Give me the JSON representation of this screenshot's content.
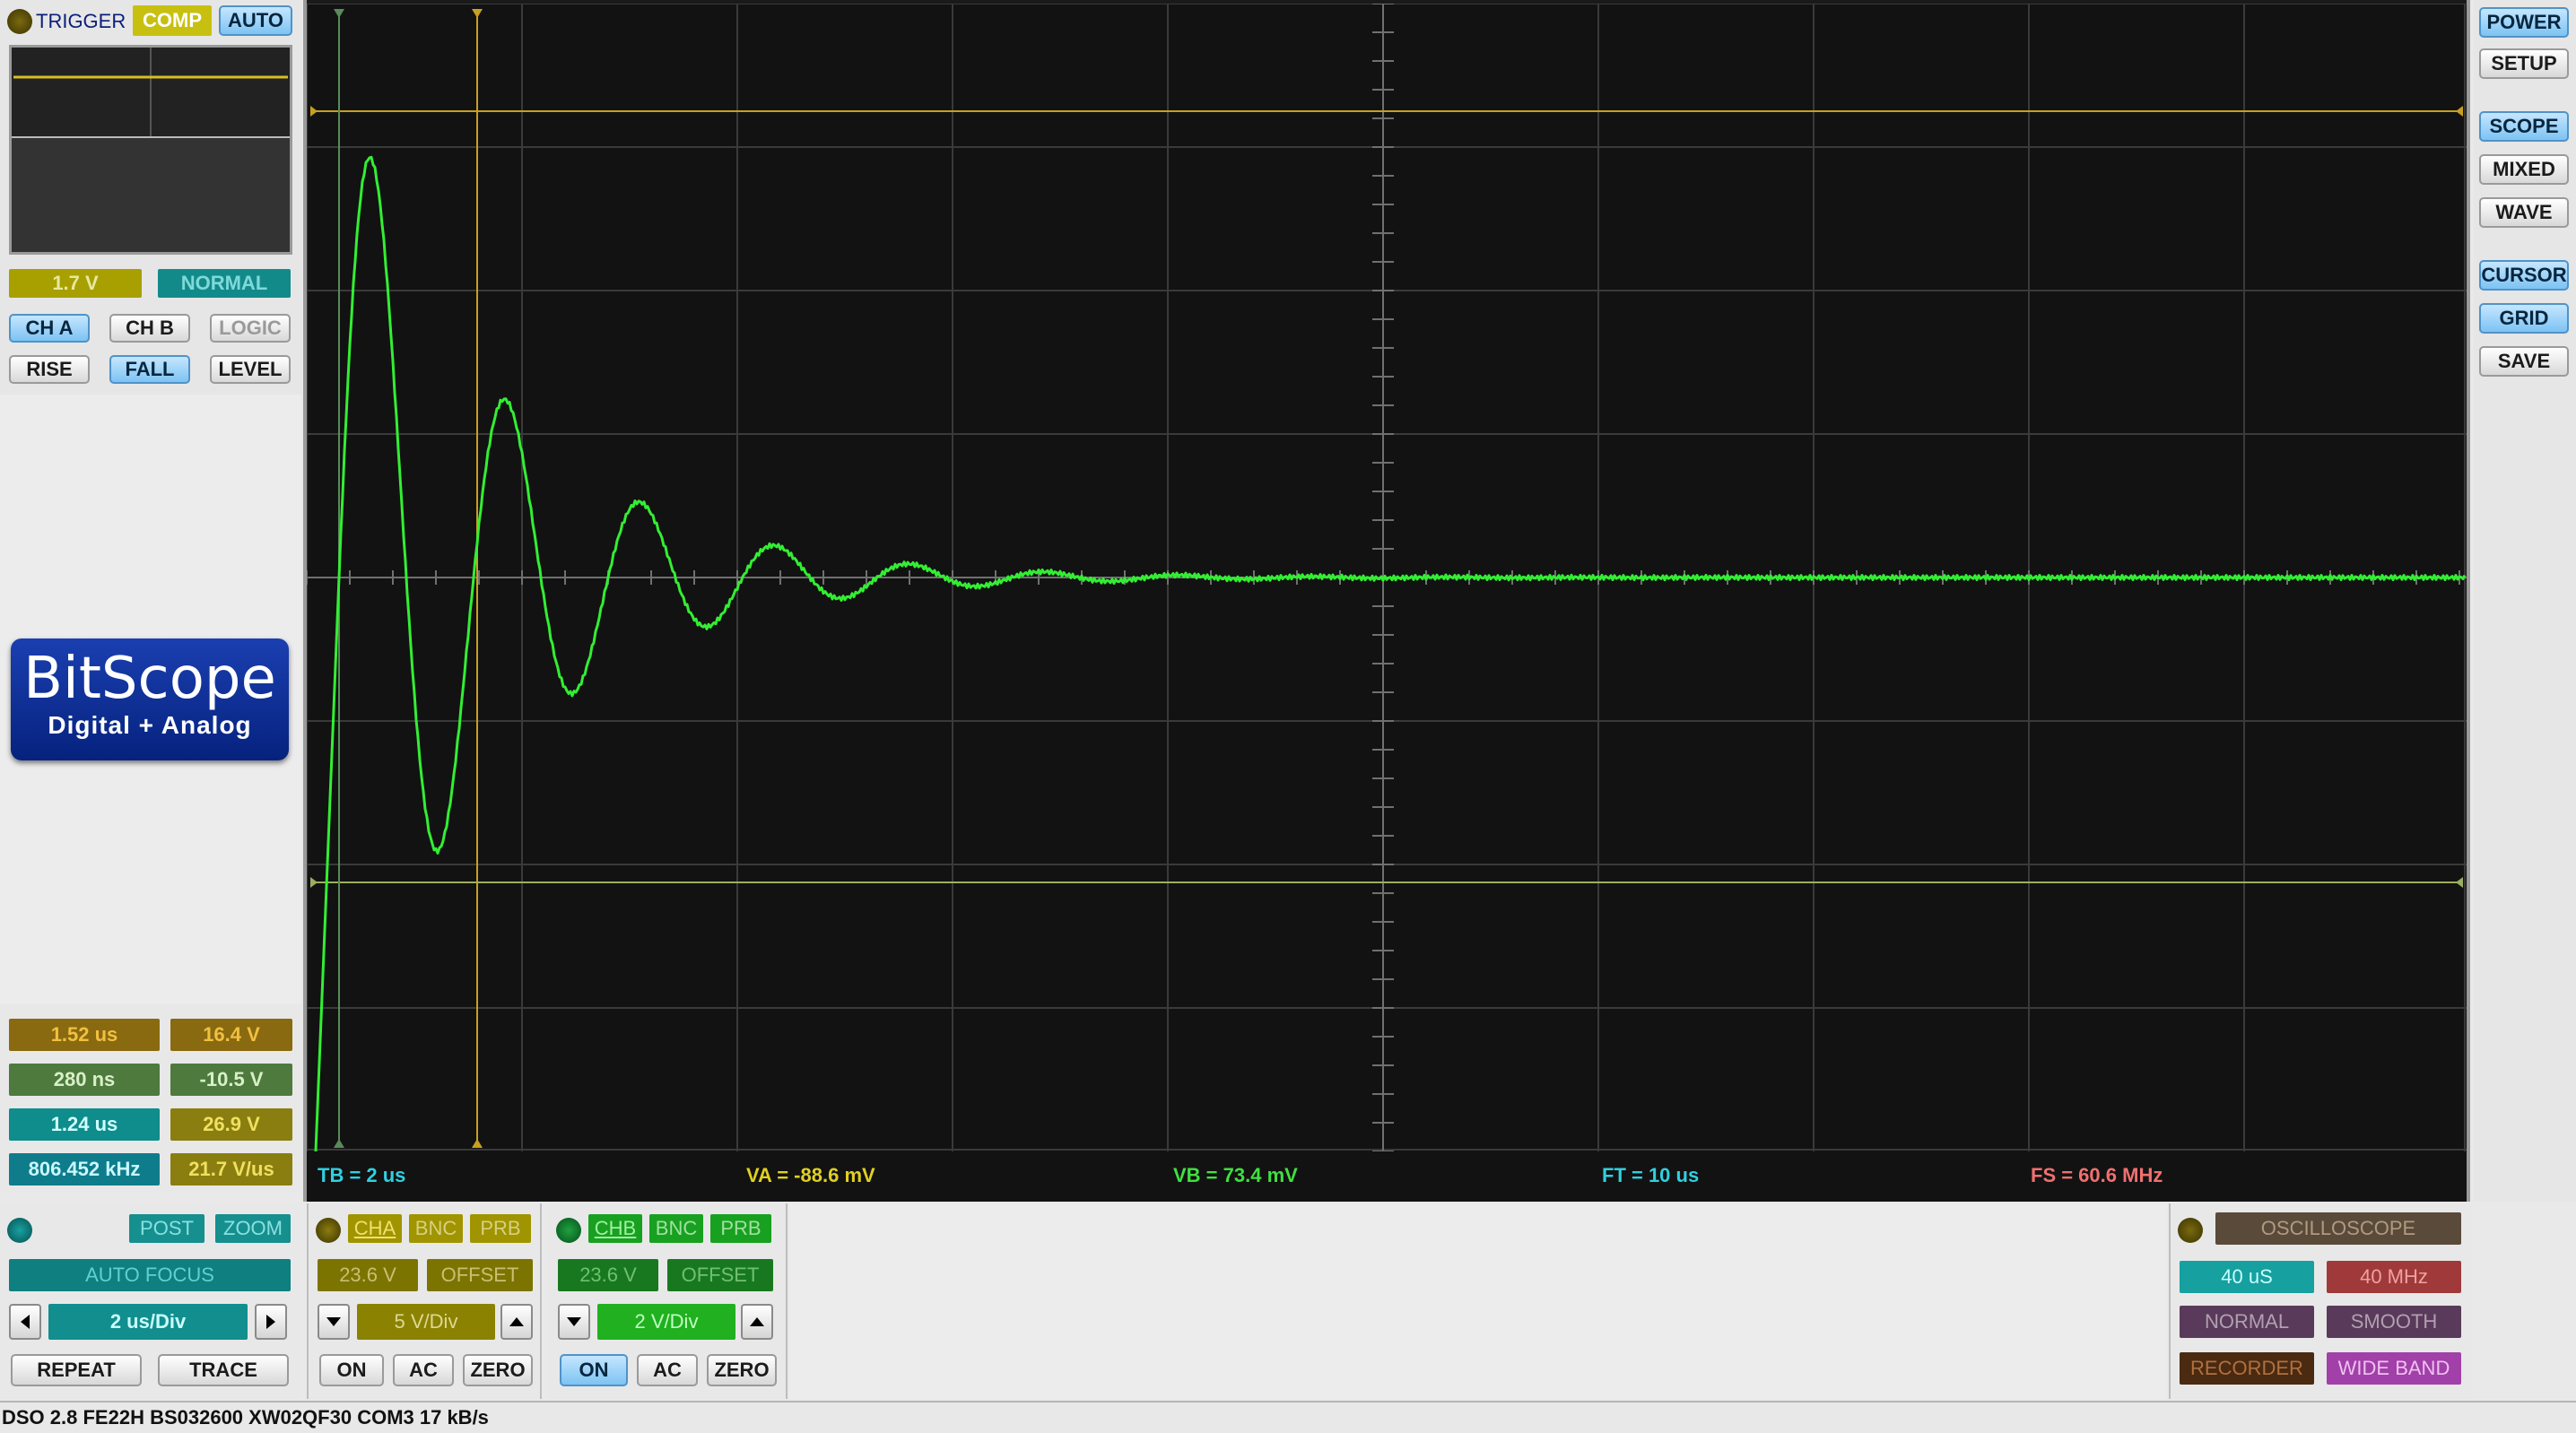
{
  "trigger": {
    "title": "TRIGGER",
    "comp_label": "COMP",
    "auto_label": "AUTO",
    "level_value": "1.7 V",
    "mode_value": "NORMAL",
    "ch_a": "CH A",
    "ch_b": "CH B",
    "logic": "LOGIC",
    "rise": "RISE",
    "fall": "FALL",
    "level": "LEVEL"
  },
  "logo": {
    "name": "BitScope",
    "tagline": "Digital + Analog"
  },
  "measurements": [
    {
      "left": "1.52 us",
      "right": "16.4 V"
    },
    {
      "left": "280 ns",
      "right": "-10.5 V"
    },
    {
      "left": "1.24 us",
      "right": "26.9 V"
    },
    {
      "left": "806.452  kHz",
      "right": "21.7 V/us"
    }
  ],
  "timebase": {
    "post": "POST",
    "zoom": "ZOOM",
    "auto_focus": "AUTO FOCUS",
    "value": "2 us/Div",
    "repeat": "REPEAT",
    "trace": "TRACE"
  },
  "channel_a": {
    "cha": "CHA",
    "bnc": "BNC",
    "prb": "PRB",
    "range": "23.6 V",
    "offset": "OFFSET",
    "scale": "5 V/Div",
    "on": "ON",
    "ac": "AC",
    "zero": "ZERO"
  },
  "channel_b": {
    "chb": "CHB",
    "bnc": "BNC",
    "prb": "PRB",
    "range": "23.6 V",
    "offset": "OFFSET",
    "scale": "2 V/Div",
    "on": "ON",
    "ac": "AC",
    "zero": "ZERO"
  },
  "scope_mode": {
    "title": "OSCILLOSCOPE",
    "duration": "40 uS",
    "bandwidth": "40 MHz",
    "normal": "NORMAL",
    "smooth": "SMOOTH",
    "recorder": "RECORDER",
    "wide_band": "WIDE BAND"
  },
  "readouts": {
    "tb": "TB = 2 us",
    "va": "VA = -88.6 mV",
    "vb": "VB = 73.4 mV",
    "ft": "FT = 10 us",
    "fs": "FS = 60.6 MHz"
  },
  "right_menu": [
    "POWER",
    "SETUP",
    "SCOPE",
    "MIXED",
    "WAVE",
    "CURSOR",
    "GRID",
    "SAVE"
  ],
  "status_text": "DSO 2.8 FE22H BS032600 XW02QF30 COM3 17 kB/s",
  "colors": {
    "trace": "#33ee33",
    "cursor": "#c8a020",
    "screen_bg": "#121212",
    "grid": "#3a3a3a"
  }
}
